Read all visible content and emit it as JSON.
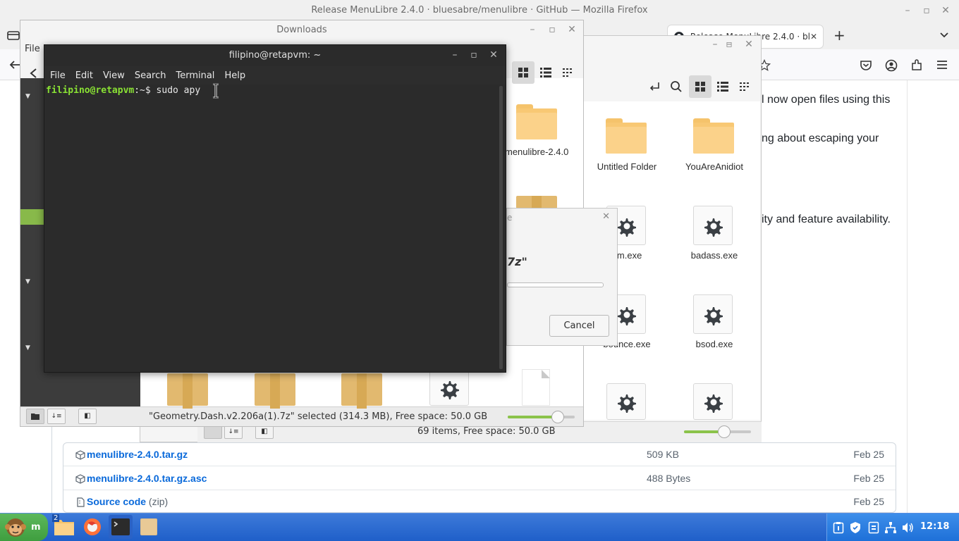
{
  "firefox": {
    "window_title": "Release MenuLibre 2.4.0 · bluesabre/menulibre · GitHub — Mozilla Firefox",
    "tab_title": "Release MenuLibre 2.4.0 · bl",
    "new_tab": "+",
    "page_fragments": [
      "l now open files using this",
      "ng about escaping your",
      "ity and feature availability."
    ],
    "assets": [
      {
        "name": "menulibre-2.4.0.tar.gz",
        "size": "509 KB",
        "date": "Feb 25"
      },
      {
        "name": "menulibre-2.4.0.tar.gz.asc",
        "size": "488 Bytes",
        "date": "Feb 25"
      },
      {
        "name": "Source code",
        "suffix": "(zip)",
        "size": "",
        "date": "Feb 25"
      }
    ]
  },
  "file_manager_back": {
    "items": [
      {
        "label": "Untitled Folder",
        "kind": "folder"
      },
      {
        "label": "YouAreAnidiot",
        "kind": "folder"
      },
      {
        "label": "om.exe",
        "kind": "exe"
      },
      {
        "label": "badass.exe",
        "kind": "exe"
      },
      {
        "label": "bounce.exe",
        "kind": "exe"
      },
      {
        "label": "bsod.exe",
        "kind": "exe"
      }
    ],
    "status": "69 items, Free space: 50.0 GB",
    "zoom_level": 0.6
  },
  "downloads_window": {
    "title": "Downloads",
    "menu_file": "File",
    "visible_item": "menulibre-2.4.0",
    "status": "\"Geometry.Dash.v2.206a(1).7z\" selected (314.3 MB), Free space: 50.0 GB",
    "zoom_level": 0.75
  },
  "progress_dialog": {
    "title_fragment": "e",
    "file_fragment": "7z\"",
    "cancel_label": "Cancel"
  },
  "terminal": {
    "title": "filipino@retapvm: ~",
    "menu": [
      "File",
      "Edit",
      "View",
      "Search",
      "Terminal",
      "Help"
    ],
    "prompt_user": "filipino@retapvm",
    "prompt_path": ":~$",
    "command": " sudo apy"
  },
  "taskbar": {
    "start_label": "m",
    "files_badge": "2",
    "clock": "12:18"
  },
  "colors": {
    "taskbar": "#1f5fc9",
    "terminal_bg": "#2b2b2b",
    "prompt_green": "#8ae234",
    "link_blue": "#0969da",
    "folder": "#f8c874"
  }
}
